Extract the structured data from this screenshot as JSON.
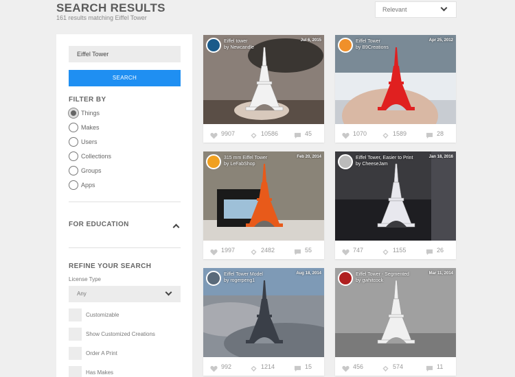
{
  "header": {
    "title": "SEARCH RESULTS",
    "subtitle": "161 results matching Eiffel Tower",
    "sort": {
      "selected": "Relevant"
    }
  },
  "sidebar": {
    "search": {
      "value": "Eiffel Tower",
      "button": "SEARCH"
    },
    "filter": {
      "heading": "FILTER BY",
      "options": [
        {
          "label": "Things",
          "selected": true
        },
        {
          "label": "Makes",
          "selected": false
        },
        {
          "label": "Users",
          "selected": false
        },
        {
          "label": "Collections",
          "selected": false
        },
        {
          "label": "Groups",
          "selected": false
        },
        {
          "label": "Apps",
          "selected": false
        }
      ]
    },
    "education": {
      "heading": "FOR EDUCATION"
    },
    "refine": {
      "heading": "REFINE YOUR SEARCH",
      "license_label": "License Type",
      "license_value": "Any",
      "checkboxes": [
        {
          "label": "Customizable"
        },
        {
          "label": "Show Customized Creations"
        },
        {
          "label": "Order A Print"
        },
        {
          "label": "Has Makes"
        }
      ]
    }
  },
  "cards": [
    {
      "title": "Eiffel tower",
      "by": "by Newcandle",
      "date": "Jul 6, 2015",
      "likes": "9907",
      "collects": "10586",
      "comments": "45",
      "avatar_color": "#1a5a8a",
      "tower_color": "#f2f2f2",
      "bg": "#8a7f78"
    },
    {
      "title": "Eiffel Tower",
      "by": "by B9Creations",
      "date": "Apr 25, 2012",
      "likes": "1070",
      "collects": "1589",
      "comments": "28",
      "avatar_color": "#f0902a",
      "tower_color": "#e02020",
      "bg": "#c8ccd2"
    },
    {
      "title": "315 mm Eiffel Tower",
      "by": "by LeFabShop",
      "date": "Feb 20, 2014",
      "likes": "1997",
      "collects": "2482",
      "comments": "55",
      "avatar_color": "#f0a020",
      "tower_color": "#e85a1a",
      "bg": "#6e6a66"
    },
    {
      "title": "Eiffel Tower, Easier to Print",
      "by": "by CheeseJam",
      "date": "Jan 18, 2016",
      "likes": "747",
      "collects": "1155",
      "comments": "26",
      "avatar_color": "#bbbbbb",
      "tower_color": "#e8e8ee",
      "bg": "#3a3a3e"
    },
    {
      "title": "Eiffel Tower Model",
      "by": "by rogerpeng1",
      "date": "Aug 18, 2014",
      "likes": "992",
      "collects": "1214",
      "comments": "15",
      "avatar_color": "#5a6a7a",
      "tower_color": "#3a3f48",
      "bg": "#8a9098"
    },
    {
      "title": "Eiffel Tower - Segmented",
      "by": "by gwhitcock",
      "date": "Mar 11, 2014",
      "likes": "456",
      "collects": "574",
      "comments": "11",
      "avatar_color": "#b02020",
      "tower_color": "#f0f0f0",
      "bg": "#a0a0a0"
    }
  ]
}
